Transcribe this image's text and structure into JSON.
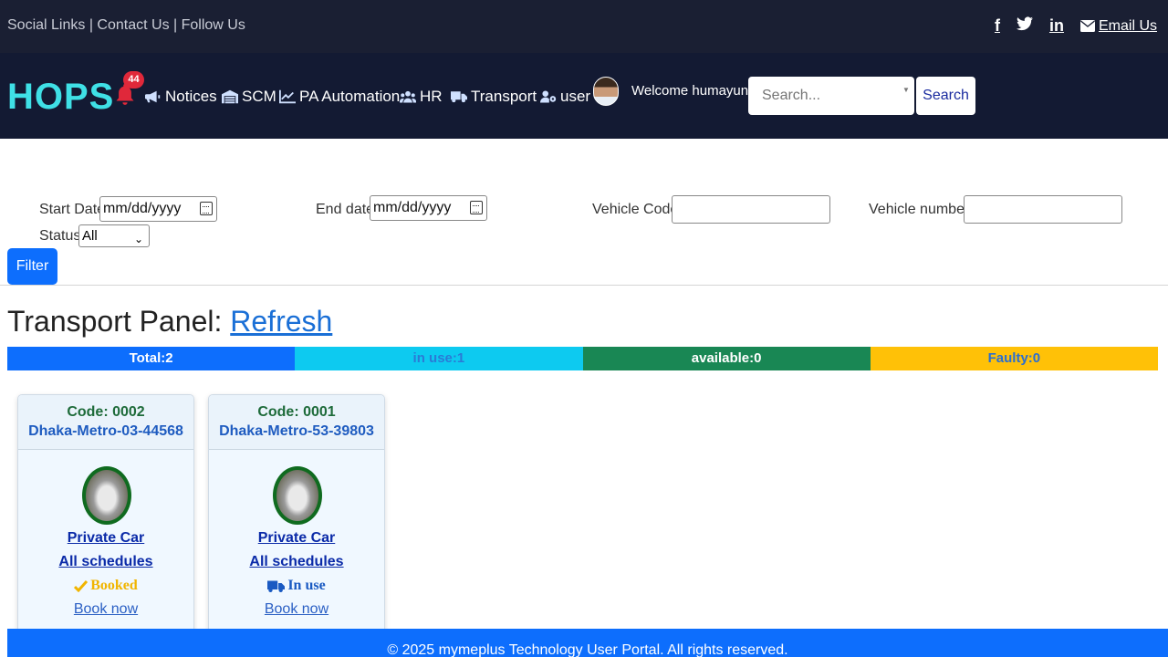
{
  "topbar": {
    "links": [
      "Social Links",
      "Contact Us",
      "Follow Us"
    ],
    "separator": " | ",
    "social": [
      "f",
      "t",
      "in"
    ],
    "email_label": "Email Us"
  },
  "navbar": {
    "logo": "HOPS",
    "notification_count": "44",
    "items": [
      "Notices",
      "SCM",
      "PA Automation",
      "HR",
      "Transport",
      "user"
    ],
    "welcome": "Welcome humayun",
    "search_placeholder": "Search...",
    "search_button": "Search"
  },
  "filters": {
    "start_label": "Start Date:",
    "start_value": "mm/dd/yyyy",
    "end_label": "End date:",
    "end_value": "mm/dd/yyyy",
    "vehicle_code_label": "Vehicle Code:",
    "vehicle_number_label": "Vehicle number:",
    "status_label": "Status:",
    "status_value": "All",
    "filter_button": "Filter"
  },
  "panel": {
    "title": "Transport Panel: ",
    "refresh": "Refresh"
  },
  "stats": {
    "total": "Total:2",
    "in_use": "in use:1",
    "available": "available:0",
    "faulty": "Faulty:0"
  },
  "vehicles": [
    {
      "code": "Code: 0002",
      "plate": "Dhaka-Metro-03-44568",
      "type": "Private Car",
      "schedules": "All schedules",
      "status": "Booked",
      "book": "Book now"
    },
    {
      "code": "Code: 0001",
      "plate": "Dhaka-Metro-53-39803",
      "type": "Private Car",
      "schedules": "All schedules",
      "status": "In use",
      "book": "Book now"
    }
  ],
  "footer": "© 2025 mymeplus Technology User Portal. All rights reserved.",
  "colors": {
    "primary": "#0d6efd",
    "info": "#0dcaf0",
    "success": "#198754",
    "warning": "#ffc107",
    "nav_bg": "#131a33",
    "logo": "#3fe0e6"
  },
  "icons": [
    "bell-icon",
    "megaphone-icon",
    "warehouse-icon",
    "chart-line-icon",
    "users-icon",
    "truck-icon",
    "user-gear-icon",
    "envelope-icon",
    "calendar-icon",
    "check-icon"
  ]
}
